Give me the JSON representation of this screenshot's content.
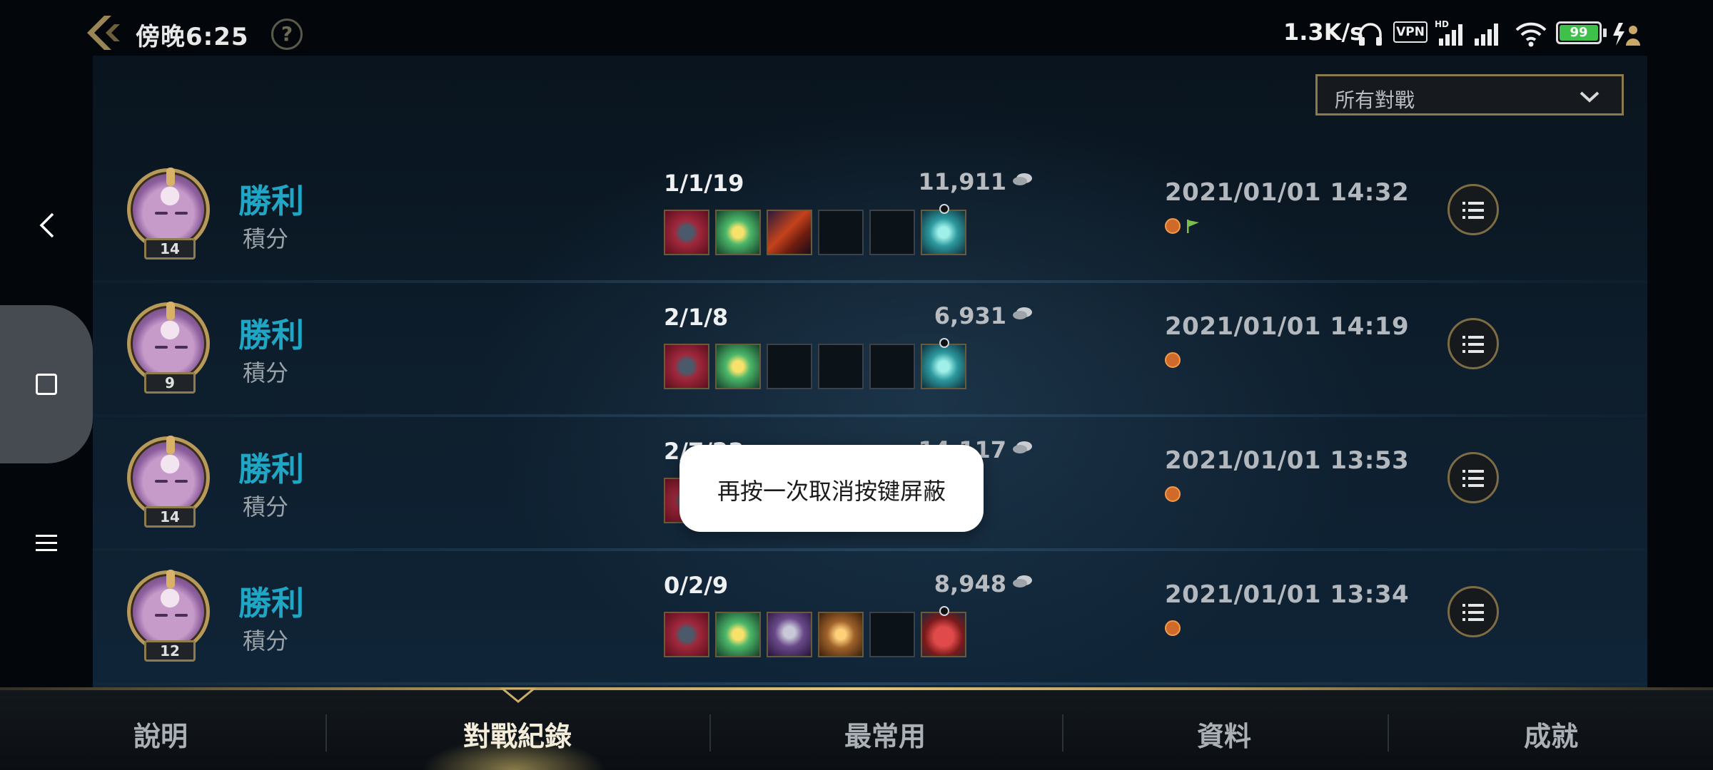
{
  "status_bar": {
    "time": "傍晚6:25",
    "help": "?",
    "net_speed": "1.3K/s",
    "vpn": "VPN",
    "battery": "99"
  },
  "filter": {
    "selected": "所有對戰"
  },
  "matches": [
    {
      "result": "勝利",
      "mode": "積分",
      "level": "14",
      "kda": "1/1/19",
      "gold": "11,911",
      "date": "2021/01/01 14:32",
      "items": [
        "item-red",
        "item-green",
        "item-hat",
        "empty",
        "empty",
        "item-trinket"
      ],
      "extra": [
        "ward",
        "flag"
      ]
    },
    {
      "result": "勝利",
      "mode": "積分",
      "level": "9",
      "kda": "2/1/8",
      "gold": "6,931",
      "date": "2021/01/01 14:19",
      "items": [
        "item-red",
        "item-green",
        "empty",
        "empty",
        "empty",
        "item-trinket"
      ],
      "extra": [
        "ward"
      ]
    },
    {
      "result": "勝利",
      "mode": "積分",
      "level": "14",
      "kda": "2/7/23",
      "gold": "14,117",
      "date": "2021/01/01 13:53",
      "items": [
        "item-red",
        "item-green",
        "empty",
        "empty",
        "empty",
        "item-trinket"
      ],
      "extra": [
        "ward"
      ]
    },
    {
      "result": "勝利",
      "mode": "積分",
      "level": "12",
      "kda": "0/2/9",
      "gold": "8,948",
      "date": "2021/01/01 13:34",
      "items": [
        "item-red",
        "item-green",
        "item-staff",
        "item-tome",
        "empty",
        "item-boots"
      ],
      "extra": [
        "ward"
      ]
    }
  ],
  "toast": {
    "message": "再按一次取消按键屏蔽"
  },
  "tabs": [
    {
      "label": "說明",
      "active": false
    },
    {
      "label": "對戰紀錄",
      "active": true
    },
    {
      "label": "最常用",
      "active": false
    },
    {
      "label": "資料",
      "active": false
    },
    {
      "label": "成就",
      "active": false
    }
  ],
  "colors": {
    "accent_gold": "#b59a5c",
    "victory": "#1fa6c4",
    "battery": "#3fc04b"
  },
  "icons": [
    "back-icon",
    "help-icon",
    "headset-icon",
    "hd-signal-icon",
    "signal-icon",
    "wifi-icon",
    "charge-icon",
    "chevron-down-icon",
    "gold-icon",
    "list-icon",
    "ward-icon",
    "flag-icon",
    "side-back-icon",
    "side-square-icon",
    "side-menu-icon"
  ]
}
